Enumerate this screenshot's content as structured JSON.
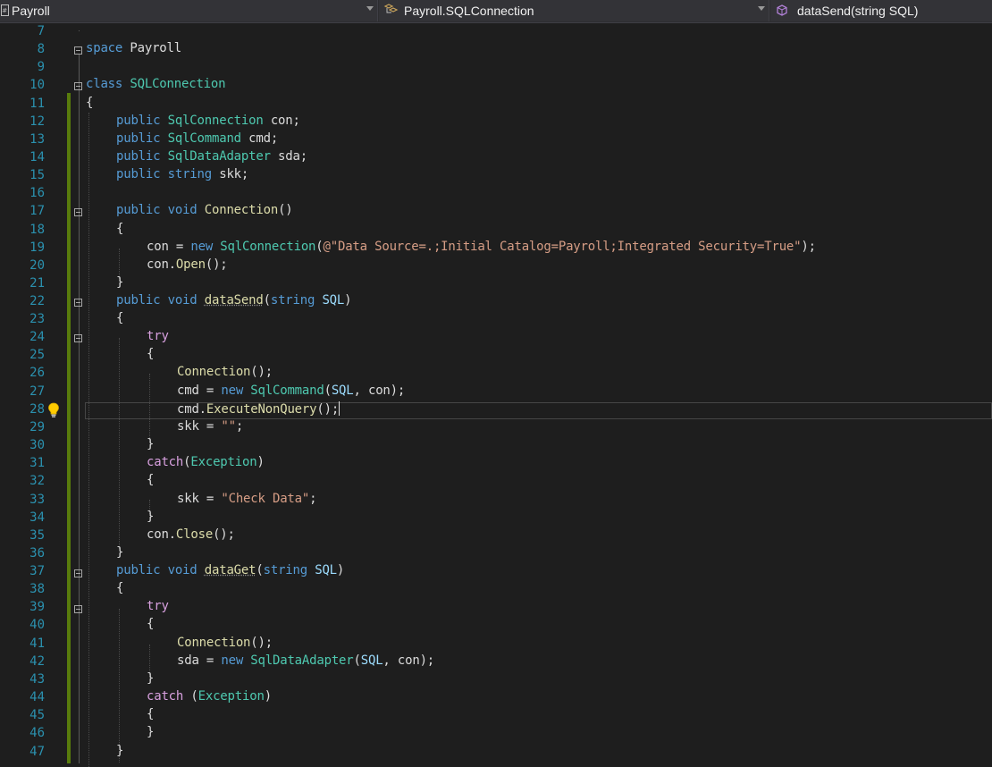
{
  "navbar": {
    "project": "Payroll",
    "type": "Payroll.SQLConnection",
    "member": "dataSend(string SQL)"
  },
  "editor": {
    "lines": [
      {
        "n": "7"
      },
      {
        "n": "8"
      },
      {
        "n": "9"
      },
      {
        "n": "10"
      },
      {
        "n": "11"
      },
      {
        "n": "12"
      },
      {
        "n": "13"
      },
      {
        "n": "14"
      },
      {
        "n": "15"
      },
      {
        "n": "16"
      },
      {
        "n": "17"
      },
      {
        "n": "18"
      },
      {
        "n": "19"
      },
      {
        "n": "20"
      },
      {
        "n": "21"
      },
      {
        "n": "22"
      },
      {
        "n": "23"
      },
      {
        "n": "24"
      },
      {
        "n": "25"
      },
      {
        "n": "26"
      },
      {
        "n": "27"
      },
      {
        "n": "28"
      },
      {
        "n": "29"
      },
      {
        "n": "30"
      },
      {
        "n": "31"
      },
      {
        "n": "32"
      },
      {
        "n": "33"
      },
      {
        "n": "34"
      },
      {
        "n": "35"
      },
      {
        "n": "36"
      },
      {
        "n": "37"
      },
      {
        "n": "38"
      },
      {
        "n": "39"
      },
      {
        "n": "40"
      },
      {
        "n": "41"
      },
      {
        "n": "42"
      },
      {
        "n": "43"
      },
      {
        "n": "44"
      },
      {
        "n": "45"
      },
      {
        "n": "46"
      },
      {
        "n": "47"
      }
    ],
    "code": {
      "l8": {
        "kw": "space",
        "rest": " Payroll"
      },
      "l10": {
        "kw": "class",
        "name": "SQLConnection"
      },
      "l11": "{",
      "l12": {
        "kw": "public",
        "ty": "SqlConnection",
        "rest": " con;"
      },
      "l13": {
        "kw": "public",
        "ty": "SqlCommand",
        "rest": " cmd;"
      },
      "l14": {
        "kw": "public",
        "ty": "SqlDataAdapter",
        "rest": " sda;"
      },
      "l15": {
        "kw": "public",
        "kw2": "string",
        "rest": " skk;"
      },
      "l17": {
        "kw": "public",
        "kw2": "void",
        "fn": "Connection",
        "rest": "()"
      },
      "l18": "{",
      "l19": {
        "a": "con = ",
        "kw": "new",
        "ty": "SqlConnection",
        "b": "(",
        "st": "@\"Data Source=.;Initial Catalog=Payroll;Integrated Security=True\"",
        "c": ");"
      },
      "l20": {
        "a": "con.",
        "fn": "Open",
        "b": "();"
      },
      "l21": "}",
      "l22": {
        "kw": "public",
        "kw2": "void",
        "fn": "dataSend",
        "b": "(",
        "kw3": "string",
        "par": "SQL",
        "c": ")"
      },
      "l23": "{",
      "l24": "try",
      "l25": "{",
      "l26": {
        "fn": "Connection",
        "b": "();"
      },
      "l27": {
        "a": "cmd = ",
        "kw": "new",
        "ty": "SqlCommand",
        "b": "(",
        "par": "SQL",
        "c": ", con);"
      },
      "l28": {
        "a": "cmd.",
        "fn": "ExecuteNonQuery",
        "b": "();"
      },
      "l29": {
        "a": "skk = ",
        "st": "\"\"",
        "b": ";"
      },
      "l30": "}",
      "l31": {
        "ctl": "catch",
        "b": "(",
        "ty": "Exception",
        "c": ")"
      },
      "l32": "{",
      "l33": {
        "a": "skk = ",
        "st": "\"Check Data\"",
        "b": ";"
      },
      "l34": "}",
      "l35": {
        "a": "con.",
        "fn": "Close",
        "b": "();"
      },
      "l36": "}",
      "l37": {
        "kw": "public",
        "kw2": "void",
        "fn": "dataGet",
        "b": "(",
        "kw3": "string",
        "par": "SQL",
        "c": ")"
      },
      "l38": "{",
      "l39": "try",
      "l40": "{",
      "l41": {
        "fn": "Connection",
        "b": "();"
      },
      "l42": {
        "a": "sda = ",
        "kw": "new",
        "ty": "SqlDataAdapter",
        "b": "(",
        "par": "SQL",
        "c": ", con);"
      },
      "l43": "}",
      "l44": {
        "ctl": "catch",
        "b": " (",
        "ty": "Exception",
        "c": ")"
      },
      "l45": "{",
      "l46": "}",
      "l47": "}"
    }
  },
  "colors": {
    "background": "#1e1e1e",
    "keyword": "#569cd6",
    "type": "#4ec9b0",
    "method": "#dcdcaa",
    "string": "#d69d85",
    "control": "#d8a0df",
    "parameter": "#9cdcfe",
    "line_number": "#2b91af",
    "change_bar": "#587c0c"
  },
  "icons": {
    "project": "csharp-project-icon",
    "type": "class-icon",
    "member": "method-cube-icon",
    "quick_action": "lightbulb-icon"
  }
}
